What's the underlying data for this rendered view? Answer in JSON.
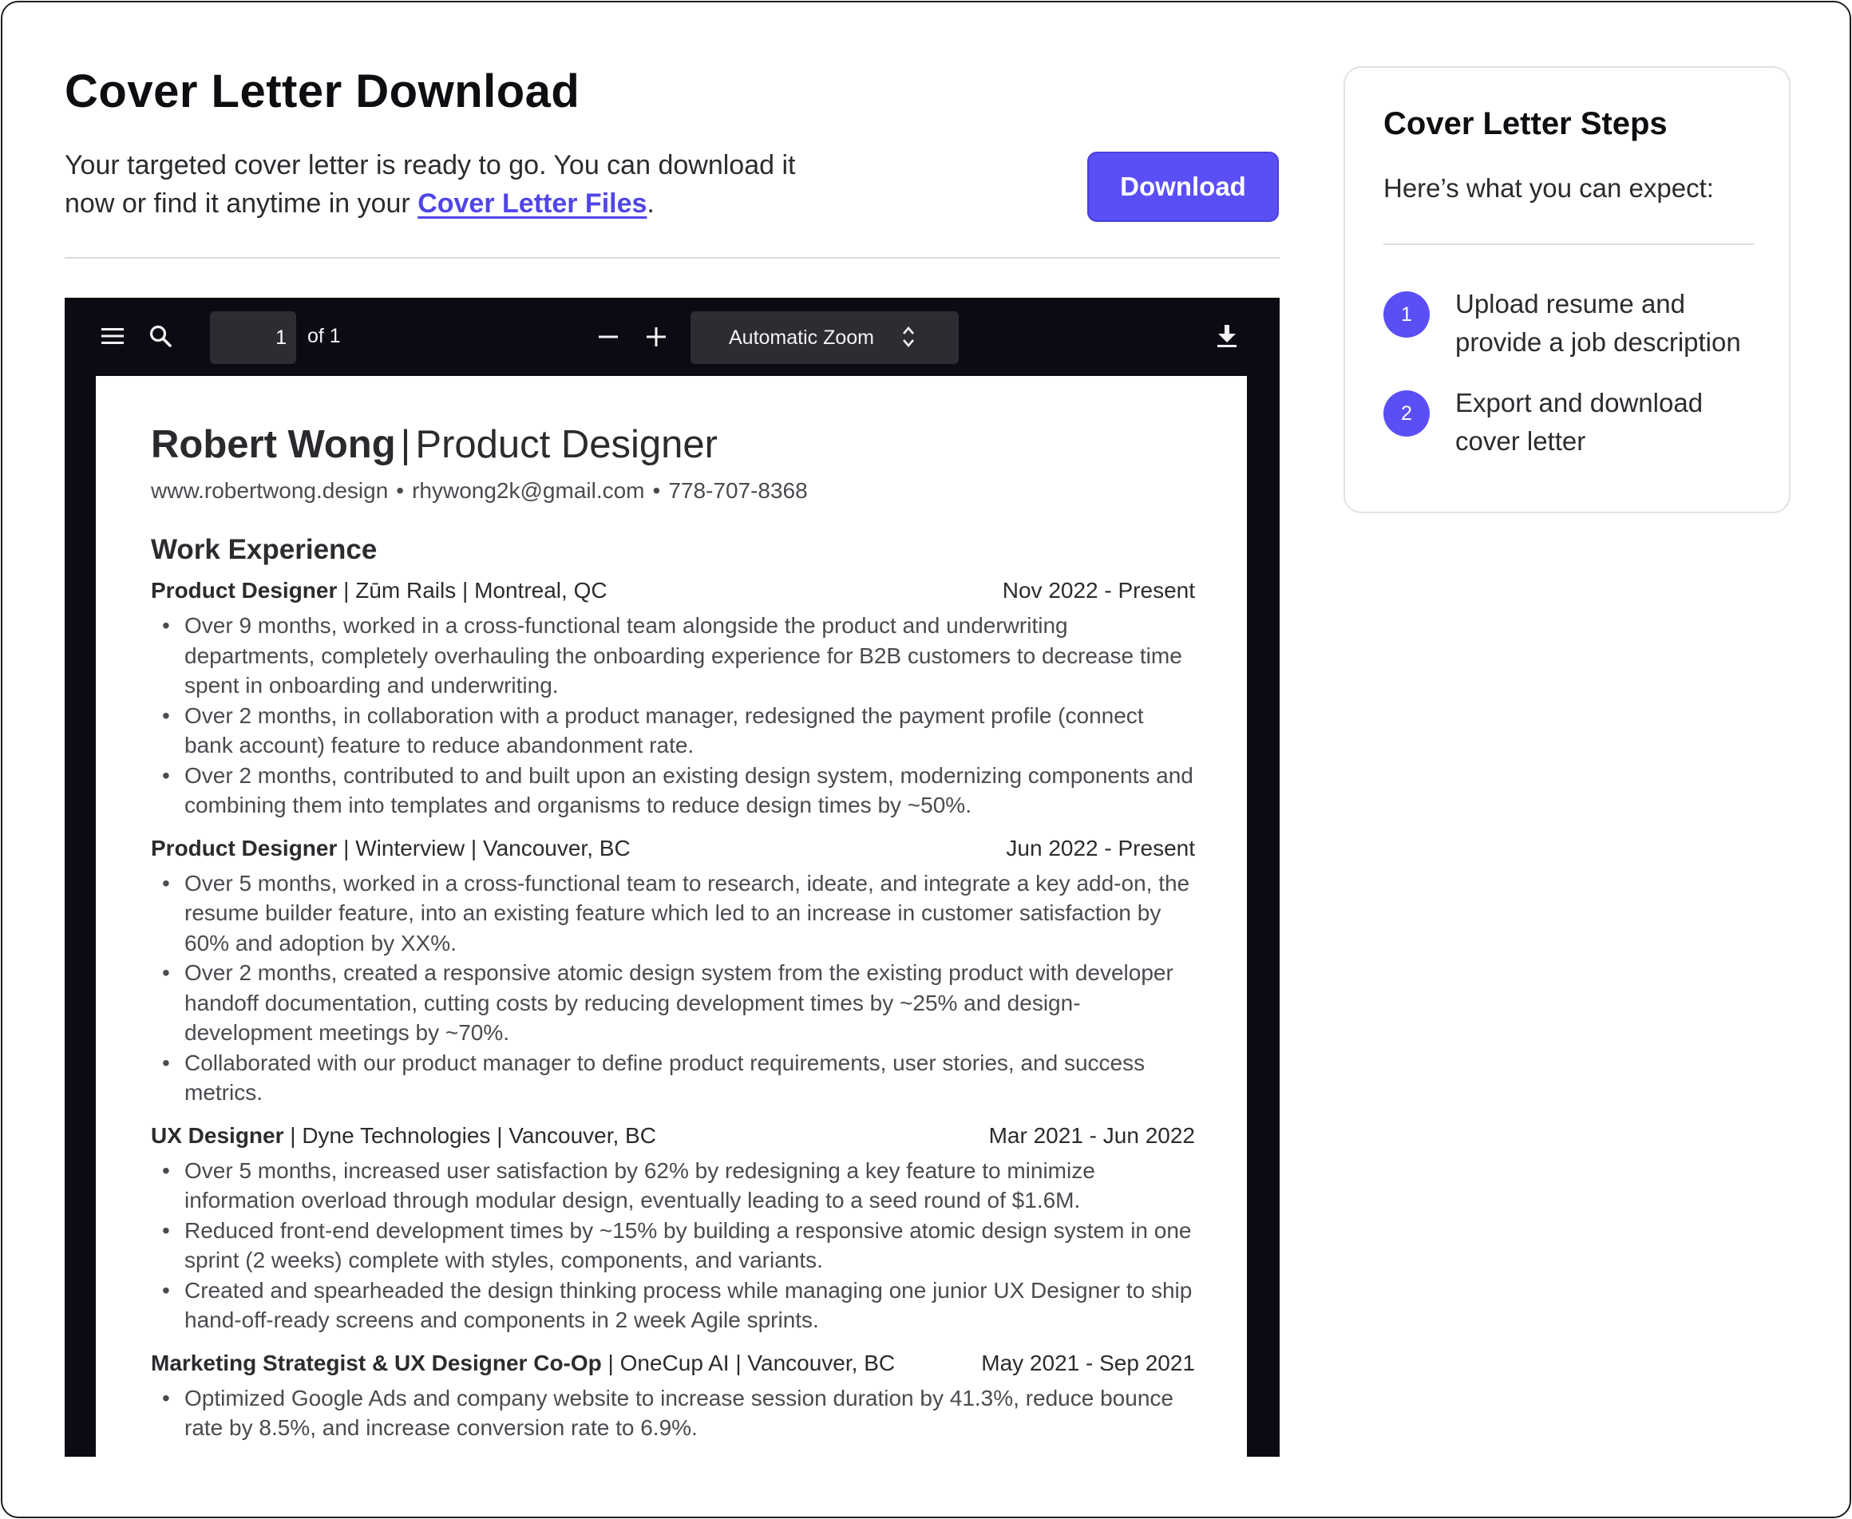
{
  "header": {
    "title": "Cover Letter Download",
    "intro_text": "Your targeted cover letter is ready to go. You can download it now or find it anytime in your ",
    "intro_link": "Cover Letter Files",
    "intro_end": ".",
    "download_label": "Download"
  },
  "viewer": {
    "page_number": "1",
    "page_of": "of 1",
    "zoom": "Automatic Zoom",
    "icons": [
      "menu-icon",
      "search-icon",
      "minus-icon",
      "plus-icon",
      "chevron-updown-icon",
      "download-icon"
    ]
  },
  "resume": {
    "name": "Robert Wong",
    "separator": "|",
    "headline": "Product Designer",
    "website": "www.robertwong.design",
    "email": "rhywong2k@gmail.com",
    "phone": "778-707-8368",
    "contact_dot": "•",
    "section_title": "Work Experience",
    "jobs": [
      {
        "role": "Product Designer",
        "details": " | Zūm Rails | Montreal, QC",
        "dates": "Nov 2022 - Present",
        "bullets": [
          "Over 9 months, worked in a cross-functional team alongside the product and underwriting departments, completely overhauling the onboarding experience for B2B customers to decrease time spent in onboarding and underwriting.",
          "Over 2 months, in collaboration with a product manager, redesigned the payment profile (connect bank account) feature to reduce abandonment rate.",
          "Over 2 months, contributed to and built upon an existing design system, modernizing components and combining them into templates and organisms to reduce design times by ~50%."
        ]
      },
      {
        "role": "Product Designer",
        "details": " | Winterview | Vancouver, BC",
        "dates": "Jun 2022 - Present",
        "bullets": [
          "Over 5 months, worked in a cross-functional team to research, ideate, and integrate a key add-on, the resume builder feature, into an existing feature which led to an increase in customer satisfaction by 60% and adoption by XX%.",
          "Over 2 months, created a responsive atomic design system from the existing product with developer handoff documentation, cutting costs by reducing development times by ~25% and design-development meetings by ~70%.",
          "Collaborated with our product manager to define product requirements, user stories, and success metrics."
        ]
      },
      {
        "role": "UX Designer",
        "details": " | Dyne Technologies | Vancouver, BC",
        "dates": "Mar 2021 - Jun 2022",
        "bullets": [
          "Over 5 months, increased user satisfaction by 62% by redesigning a key feature to minimize information overload through modular design, eventually leading to a seed round of $1.6M.",
          "Reduced front-end development times by ~15% by building a responsive atomic design system in one sprint (2 weeks) complete with styles, components, and variants.",
          "Created and spearheaded the design thinking process while managing one junior UX Designer to ship hand-off-ready screens and components in 2 week Agile sprints."
        ]
      },
      {
        "role": "Marketing Strategist & UX Designer Co-Op",
        "details": " | OneCup AI | Vancouver, BC",
        "dates": "May 2021 - Sep 2021",
        "bullets": [
          "Optimized Google Ads and company website to increase session duration by 41.3%, reduce bounce rate by 8.5%, and increase conversion rate to 6.9%."
        ]
      }
    ]
  },
  "steps": {
    "title": "Cover Letter Steps",
    "subtitle": "Here’s what you can expect:",
    "items": [
      {
        "number": "1",
        "text": "Upload resume and provide a job description"
      },
      {
        "number": "2",
        "text": "Export and download cover letter"
      }
    ]
  },
  "colors": {
    "accent": "#5a4ff5",
    "link": "#5046e5",
    "viewer_bg": "#0b0b14"
  }
}
